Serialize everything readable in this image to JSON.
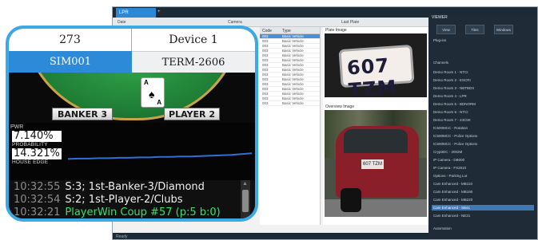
{
  "background_app": {
    "tab_label": "LPR",
    "toolbar": [
      "Date",
      "Camera",
      "Last Plate"
    ],
    "list_headers": [
      "Code",
      "Type"
    ],
    "list_rows": [
      {
        "code": "003",
        "type": "Basic Vehicle"
      },
      {
        "code": "003",
        "type": "Basic Vehicle"
      },
      {
        "code": "003",
        "type": "Basic Vehicle"
      },
      {
        "code": "003",
        "type": "Basic Vehicle"
      },
      {
        "code": "003",
        "type": "Basic Vehicle"
      },
      {
        "code": "003",
        "type": "Basic Vehicle"
      },
      {
        "code": "003",
        "type": "Basic Vehicle"
      },
      {
        "code": "003",
        "type": "Basic Vehicle"
      },
      {
        "code": "003",
        "type": "Basic Vehicle"
      },
      {
        "code": "003",
        "type": "Basic Vehicle"
      },
      {
        "code": "003",
        "type": "Basic Vehicle"
      },
      {
        "code": "003",
        "type": "Basic Vehicle"
      },
      {
        "code": "003",
        "type": "Basic Vehicle"
      },
      {
        "code": "003",
        "type": "Basic Vehicle"
      },
      {
        "code": "003",
        "type": "Basic Vehicle"
      }
    ],
    "plate_image_label": "Plate Image",
    "overview_image_label": "Overview Image",
    "plate_text": "607 TZM",
    "right_panel": {
      "title": "VIEWER",
      "section1": "Plug-ins",
      "buttons": [
        "View",
        "Tiles",
        "Windows"
      ],
      "section2": "Channels",
      "items": [
        "Demo Room 1 - NTCI",
        "Demo Room 2 - ESCRI",
        "Demo Room 3 - NBTBDX",
        "Demo Room 4 - LPR",
        "Demo Room 5 - BDNORM",
        "Demo Room 6 - NTCI",
        "Demo Room 7 - 24C5K",
        "IC500MCC - Rotation",
        "IC500MCC - Police Options",
        "IC600MCC - Police Options",
        "CryptIDC - 2002M",
        "IP Camera - DB000",
        "IP Camera - FX2510",
        "Options - Parking Lot",
        "Cam Enhanced - MB110",
        "Cam Enhanced - MB190",
        "Cam Enhanced - MB220",
        "Cam Enhanced - SB41",
        "Cam Enhanced - NE21"
      ],
      "footer": "Automation"
    },
    "status_bar": "Ready"
  },
  "game_panel": {
    "header": {
      "table_id": "273",
      "device": "Device 1"
    },
    "tabs": {
      "sim": "SIM001",
      "term": "TERM-2606"
    },
    "card": {
      "rank": "A",
      "suit": "♠"
    },
    "seats": {
      "banker": "BANKER 3",
      "player": "PLAYER 2"
    },
    "stats": {
      "pwr_label": "PWR",
      "probability_value": "7.140%",
      "probability_label": "PROBABILITY",
      "house_edge_value": "14.321%",
      "house_edge_label": "HOUSE EDGE"
    },
    "log": [
      {
        "time": "10:32:55",
        "message": "S:3; 1st-Banker-3/Diamond",
        "color": "#f0f0f0"
      },
      {
        "time": "10:32:54",
        "message": "S:2; 1st-Player-2/Clubs",
        "color": "#f0f0f0"
      },
      {
        "time": "10:32:21",
        "message": "PlayerWin Coup #57 (p:5 b:0)",
        "color": "#37e06c"
      }
    ]
  },
  "chart_data": {
    "type": "line",
    "series": [
      {
        "values": [
          0.28,
          0.29,
          0.29,
          0.3,
          0.3,
          0.31,
          0.31,
          0.32,
          0.32,
          0.33,
          0.33,
          0.34,
          0.34,
          0.35,
          0.36,
          0.37,
          0.38,
          0.4,
          0.42
        ]
      }
    ],
    "ylim": [
      0,
      1
    ],
    "color": "#2f6fd6"
  }
}
